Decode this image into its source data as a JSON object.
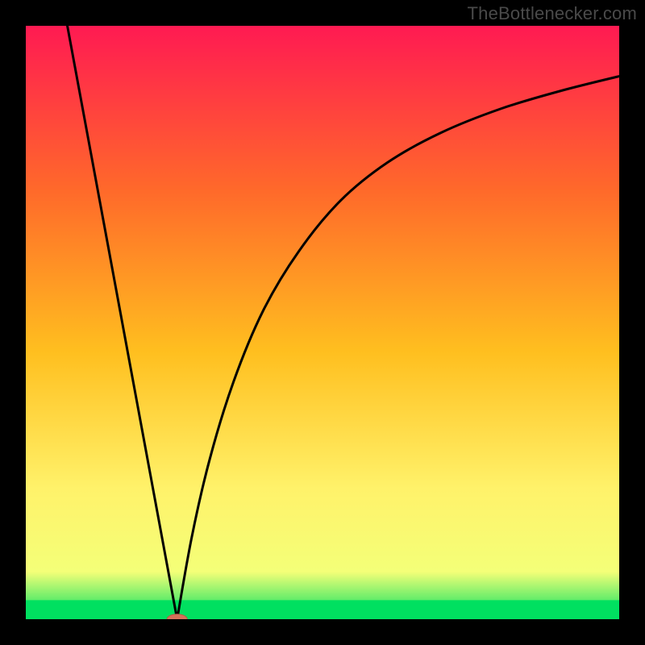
{
  "watermark": "TheBottlenecker.com",
  "colors": {
    "frame": "#000000",
    "grad_top": "#ff1a52",
    "grad_mid_upper": "#ff6a2a",
    "grad_mid": "#ffbf1f",
    "grad_mid_lower": "#fff26a",
    "grad_lower": "#f4ff78",
    "grad_bottom": "#00e060",
    "curve": "#000000",
    "marker_fill": "#d4715a",
    "marker_stroke": "#b75b45"
  },
  "chart_data": {
    "type": "line",
    "title": "",
    "xlabel": "",
    "ylabel": "",
    "xlim": [
      0,
      100
    ],
    "ylim": [
      0,
      100
    ],
    "series": [
      {
        "name": "left-segment",
        "x": [
          7,
          25.5
        ],
        "y": [
          100,
          0
        ]
      },
      {
        "name": "right-curve",
        "x": [
          25.5,
          28,
          31,
          35,
          40,
          46,
          53,
          61,
          70,
          80,
          90,
          100
        ],
        "y": [
          0,
          14,
          27,
          40,
          52,
          62,
          70.5,
          77,
          82,
          86,
          89,
          91.5
        ]
      }
    ],
    "marker": {
      "x": 25.5,
      "y": 0,
      "rx": 1.7,
      "ry": 0.85
    },
    "bottom_band_fraction": 0.032
  }
}
